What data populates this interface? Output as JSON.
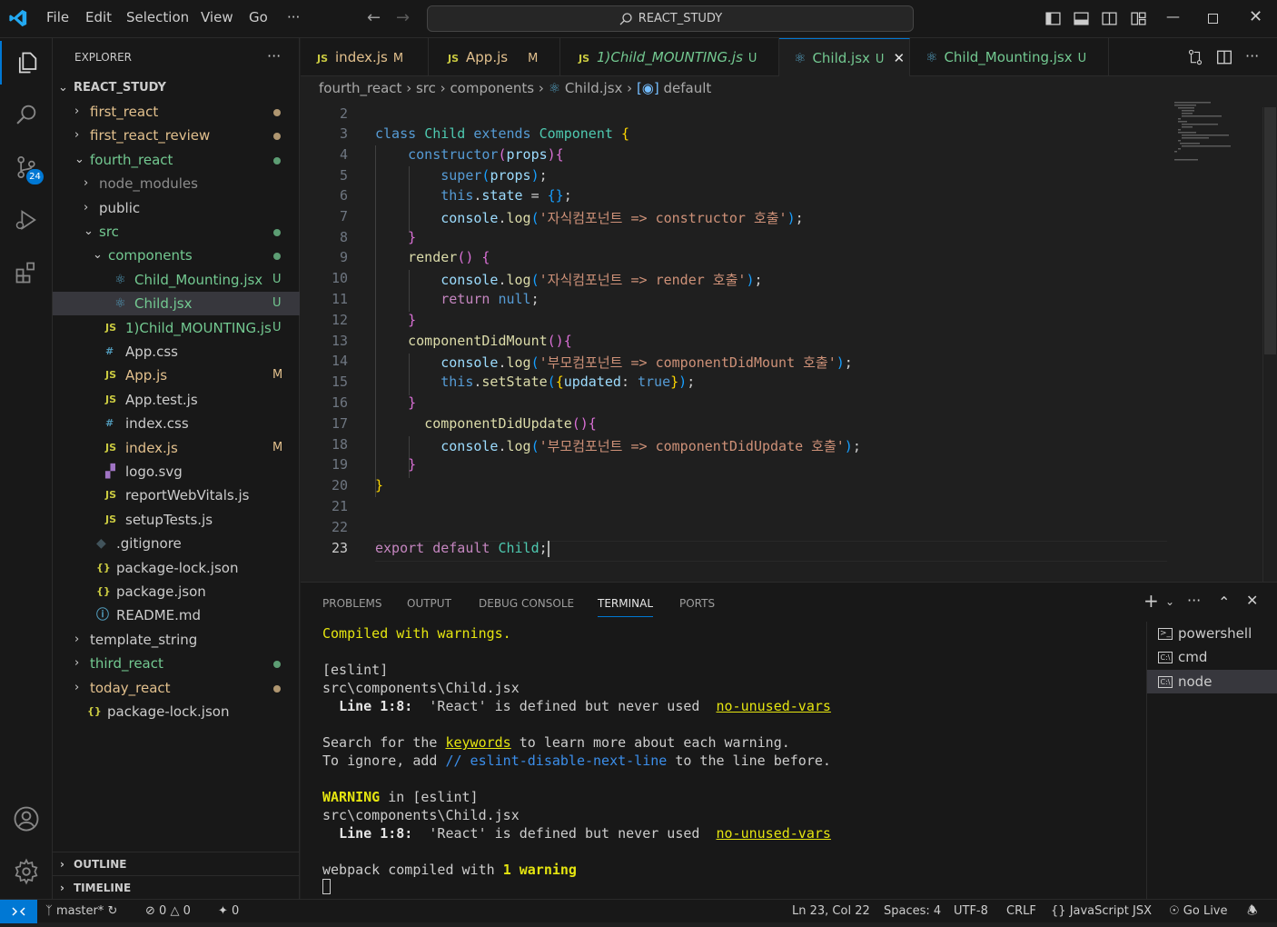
{
  "titlebar": {
    "menus": [
      "File",
      "Edit",
      "Selection",
      "View",
      "Go"
    ],
    "more": "···",
    "search_label": "REACT_STUDY"
  },
  "activity": {
    "source_control_badge": "24"
  },
  "sidebar": {
    "title": "EXPLORER",
    "more": "···",
    "root": "REACT_STUDY",
    "items": [
      {
        "label": "first_react",
        "color": "#e2c08d",
        "deco": "dot"
      },
      {
        "label": "first_react_review",
        "color": "#e2c08d",
        "deco": "dot"
      },
      {
        "label": "fourth_react",
        "color": "#73c991",
        "deco": "dot"
      },
      {
        "label": "node_modules",
        "color": "#8c8c8c",
        "deco": ""
      },
      {
        "label": "public",
        "color": "#cccccc",
        "deco": ""
      },
      {
        "label": "src",
        "color": "#73c991",
        "deco": "dot"
      },
      {
        "label": "components",
        "color": "#73c991",
        "deco": "dot"
      },
      {
        "label": "Child_Mounting.jsx",
        "color": "#73c991",
        "deco": "U"
      },
      {
        "label": "Child.jsx",
        "color": "#73c991",
        "deco": "U"
      },
      {
        "label": "1)Child_MOUNTING.js",
        "color": "#73c991",
        "deco": "U"
      },
      {
        "label": "App.css",
        "color": "#cccccc",
        "deco": ""
      },
      {
        "label": "App.js",
        "color": "#e2c08d",
        "deco": "M"
      },
      {
        "label": "App.test.js",
        "color": "#cccccc",
        "deco": ""
      },
      {
        "label": "index.css",
        "color": "#cccccc",
        "deco": ""
      },
      {
        "label": "index.js",
        "color": "#e2c08d",
        "deco": "M"
      },
      {
        "label": "logo.svg",
        "color": "#cccccc",
        "deco": ""
      },
      {
        "label": "reportWebVitals.js",
        "color": "#cccccc",
        "deco": ""
      },
      {
        "label": "setupTests.js",
        "color": "#cccccc",
        "deco": ""
      },
      {
        "label": ".gitignore",
        "color": "#cccccc",
        "deco": ""
      },
      {
        "label": "package-lock.json",
        "color": "#cccccc",
        "deco": ""
      },
      {
        "label": "package.json",
        "color": "#cccccc",
        "deco": ""
      },
      {
        "label": "README.md",
        "color": "#cccccc",
        "deco": ""
      },
      {
        "label": "template_string",
        "color": "#cccccc",
        "deco": ""
      },
      {
        "label": "third_react",
        "color": "#73c991",
        "deco": "dot"
      },
      {
        "label": "today_react",
        "color": "#e2c08d",
        "deco": "dot"
      },
      {
        "label": "package-lock.json",
        "color": "#cccccc",
        "deco": ""
      }
    ],
    "outline": "OUTLINE",
    "timeline": "TIMELINE"
  },
  "tabs": [
    {
      "label": "index.js",
      "deco": "M",
      "color": "#e2c08d"
    },
    {
      "label": "App.js",
      "deco": "M",
      "color": "#e2c08d"
    },
    {
      "label": "1)Child_MOUNTING.js",
      "deco": "U",
      "color": "#73c991"
    },
    {
      "label": "Child.jsx",
      "deco": "U",
      "color": "#73c991"
    },
    {
      "label": "Child_Mounting.jsx",
      "deco": "U",
      "color": "#73c991"
    }
  ],
  "breadcrumb": [
    "fourth_react",
    "src",
    "components",
    "Child.jsx",
    "default"
  ],
  "editor": {
    "line_numbers": [
      "2",
      "3",
      "4",
      "5",
      "6",
      "7",
      "8",
      "9",
      "10",
      "11",
      "12",
      "13",
      "14",
      "15",
      "16",
      "17",
      "18",
      "19",
      "20",
      "21",
      "22",
      "23"
    ],
    "current_line": "23"
  },
  "panel": {
    "tabs": [
      "PROBLEMS",
      "OUTPUT",
      "DEBUG CONSOLE",
      "TERMINAL",
      "PORTS"
    ],
    "active_tab": "TERMINAL",
    "terminal": {
      "l1": "Compiled with warnings.",
      "l2": "[eslint]",
      "l3": "src\\components\\Child.jsx",
      "l4_pos": "Line 1:8:",
      "l4_msg": "'React' is defined but never used",
      "l4_rule": "no-unused-vars",
      "l5_a": "Search for the ",
      "l5_link": "keywords",
      "l5_b": " to learn more about each warning.",
      "l6_a": "To ignore, add ",
      "l6_link": "// eslint-disable-next-line",
      "l6_b": " to the line before.",
      "l7_warn": "WARNING",
      "l7_b": " in [eslint]",
      "l8": "src\\components\\Child.jsx",
      "l9_pos": "Line 1:8:",
      "l9_msg": "'React' is defined but never used",
      "l9_rule": "no-unused-vars",
      "l10_a": "webpack compiled with ",
      "l10_num": "1",
      "l10_w": "warning"
    },
    "terminals": [
      "powershell",
      "cmd",
      "node"
    ],
    "active_terminal": "node"
  },
  "statusbar": {
    "branch": "master*",
    "errors": "0",
    "warnings": "0",
    "ports": "0",
    "position": "Ln 23, Col 22",
    "spaces": "Spaces: 4",
    "encoding": "UTF-8",
    "eol": "CRLF",
    "language": "JavaScript JSX",
    "golive": "Go Live"
  },
  "colors": {
    "accent": "#0078d4",
    "modified": "#e2c08d",
    "untracked": "#73c991"
  }
}
